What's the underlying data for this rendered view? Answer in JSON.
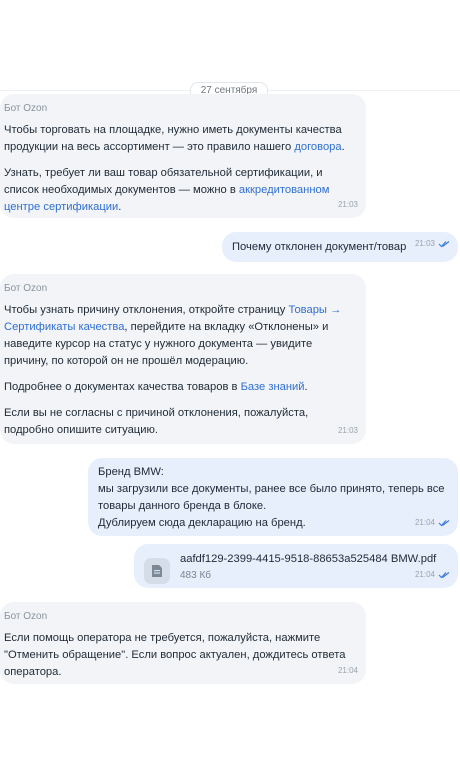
{
  "date_separator": "27 сентября",
  "messages": [
    {
      "sender": "Бот Ozon",
      "p1_a": "Чтобы торговать на площадке, нужно иметь документы качества продукции на весь ассортимент — это правило нашего ",
      "p1_link": "договора",
      "p1_b": ".",
      "p2_a": "Узнать, требует ли ваш товар обязательной сертификации, и список необходимых документов — можно в ",
      "p2_link": "аккредитованном центре сертификации",
      "p2_b": ".",
      "time": "21:03"
    },
    {
      "text": "Почему отклонен документ/товар",
      "time": "21:03"
    },
    {
      "sender": "Бот Ozon",
      "p1_a": "Чтобы узнать причину отклонения, откройте страницу ",
      "p1_link": "Товары → Сертификаты качества",
      "p1_b": ", перейдите на вкладку «Отклонены» и наведите курсор на статус у нужного документа — увидите причину, по которой он не прошёл модерацию.",
      "p2_a": "Подробнее о документах качества товаров в ",
      "p2_link": "Базе знаний",
      "p2_b": ".",
      "p3": "Если вы не согласны с причиной отклонения, пожалуйста, подробно опишите ситуацию.",
      "time": "21:03"
    },
    {
      "line1": "Бренд BMW:",
      "line2": "мы загрузили все документы, ранее все было принято, теперь все товары данного бренда в блоке.",
      "line3": "Дублируем сюда декларацию на бренд.",
      "time": "21:04"
    },
    {
      "file_name": "aafdf129-2399-4415-9518-88653a525484 BMW.pdf",
      "file_size": "483 Кб",
      "time": "21:04",
      "icon": "document-icon"
    },
    {
      "sender": "Бот Ozon",
      "p1": "Если помощь оператора не требуется, пожалуйста, нажмите \"Отменить обращение\". Если вопрос актуален, дождитесь ответа оператора.",
      "time": "21:04"
    }
  ],
  "colors": {
    "incoming_bg": "#f2f4f7",
    "outgoing_bg": "#e6effb",
    "link": "#2f6fd1",
    "read_ticks": "#3b7be0"
  }
}
